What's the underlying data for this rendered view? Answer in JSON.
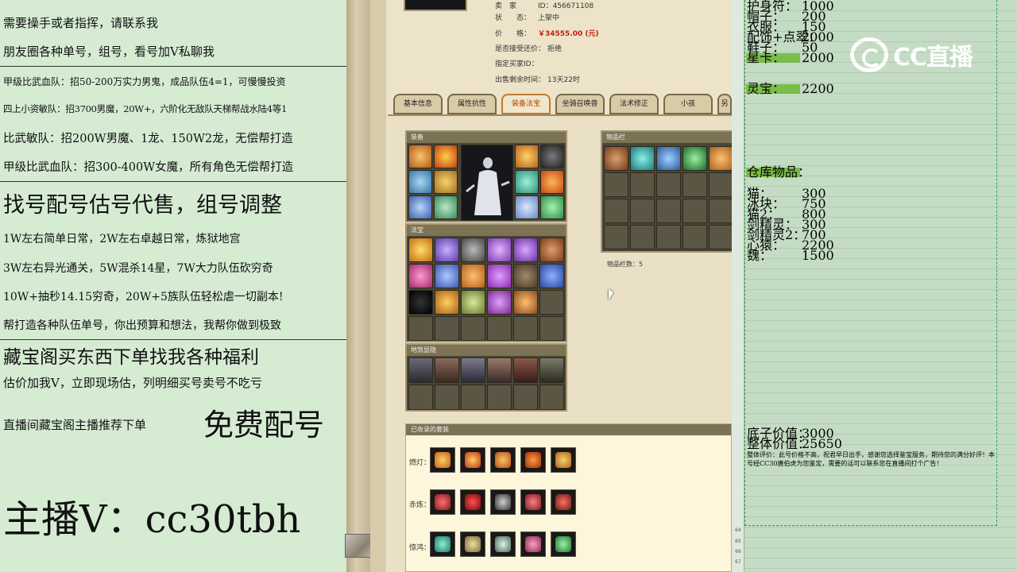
{
  "overlay": {
    "lines": [
      "需要操手或者指挥，请联系我",
      "朋友圈各种单号，组号，看号加V私聊我",
      "甲级比武血队：招50-200万实力男鬼，成品队伍4=1，可慢慢投资",
      "四上小资敏队：招3700男魔，20W+，六阶化无敌队天梯帮战水陆4等1",
      "比武敏队：招200W男魔、1龙、150W2龙，无偿帮打造",
      "甲级比武血队：招300-400W女魔，所有角色无偿帮打造",
      "找号配号估号代售，组号调整",
      "1W左右简单日常，2W左右卓越日常，炼狱地宫",
      "3W左右异光通关，5W混杀14星，7W大力队伍砍穷奇",
      "10W+抽秒14.15穷奇，20W+5族队伍轻松虐一切副本!",
      "帮打造各种队伍单号，你出预算和想法，我帮你做到极致",
      "藏宝阁买东西下单找我各种福利",
      "估价加我V，立即现场估，列明细买号卖号不吃亏",
      "直播间藏宝阁主播推荐下单",
      "免费配号",
      "主播V：cc30tbh"
    ]
  },
  "game": {
    "info": [
      {
        "k": "卖　家",
        "v": "ID：456671108"
      },
      {
        "k": "状　　态：",
        "v": "上架中"
      },
      {
        "k": "价　　格：",
        "v": "￥34555.00 (元)"
      },
      {
        "k": "是否接受还价：",
        "v": "拒绝"
      },
      {
        "k": "指定买家ID：",
        "v": ""
      },
      {
        "k": "出售剩余时间：",
        "v": "13天22时"
      }
    ],
    "price_color": "#c81d11",
    "tabs": [
      "基本信息",
      "属性抗性",
      "装备法宝",
      "坐骑召唤兽",
      "法术修正",
      "小孩",
      "另"
    ],
    "active_tab": "装备法宝",
    "equip_title": "装备",
    "fabao_title": "法宝",
    "hunpo_title": "地煞显隐",
    "items_title": "物品栏",
    "items_count": "物品栏数：5",
    "suits_title": "已收录的套装",
    "suit_rows": [
      "燃灯：",
      "赤炼：",
      "惊鸿："
    ]
  },
  "sheet": {
    "rows": [
      {
        "a": "护身符：",
        "b": "1000",
        "hl": false
      },
      {
        "a": "帽子：",
        "b": "200",
        "hl": false
      },
      {
        "a": "衣服：",
        "b": "150",
        "hl": false
      },
      {
        "a": "配饰+点翠：",
        "b": "2000",
        "hl": false
      },
      {
        "a": "鞋子：",
        "b": "50",
        "hl": false
      },
      {
        "a": "星卡：",
        "b": "2000",
        "hl": true
      },
      {
        "a": "灵宝：",
        "b": "2200",
        "hl": true
      },
      {
        "a": "仓库物品：",
        "b": "",
        "hl": true
      },
      {
        "a": "猫：",
        "b": "300",
        "hl": false
      },
      {
        "a": "冰块：",
        "b": "750",
        "hl": false
      },
      {
        "a": "猫2：",
        "b": "800",
        "hl": false
      },
      {
        "a": "剑精灵：",
        "b": "300",
        "hl": false
      },
      {
        "a": "剑精灵2：",
        "b": "700",
        "hl": false
      },
      {
        "a": "心猿：",
        "b": "2200",
        "hl": false
      },
      {
        "a": "魏：",
        "b": "1500",
        "hl": false
      },
      {
        "a": "底子价值：",
        "b": "3000",
        "hl": false
      },
      {
        "a": "整体价值：",
        "b": "25650",
        "hl": false
      }
    ],
    "remark": "整体评价：此号价格不高，祝君早日出手，感谢您选择鉴宝服务，期待您的满分好评！本号经CC30唐伯虎为您鉴定，需要的话可以联系您在直播间打个广告！",
    "row_numbers_bottom": [
      "64",
      "65",
      "66",
      "67"
    ]
  },
  "logo": {
    "text": "CC直播"
  }
}
